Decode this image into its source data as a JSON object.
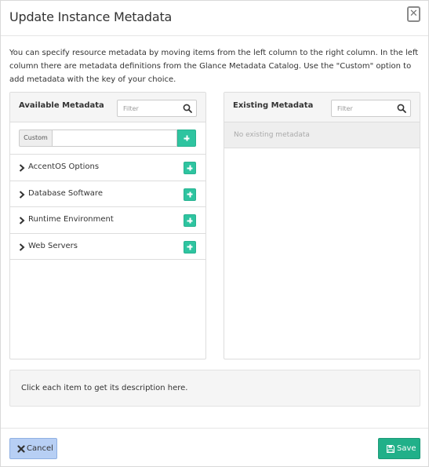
{
  "dialog": {
    "title": "Update Instance Metadata",
    "description": "You can specify resource metadata by moving items from the left column to the right column. In the left column there are metadata definitions from the Glance Metadata Catalog. Use the \"Custom\" option to add metadata with the key of your choice."
  },
  "available": {
    "title": "Available Metadata",
    "filter_placeholder": "Filter",
    "custom_label": "Custom",
    "custom_value": "",
    "items": [
      {
        "label": "AccentOS Options"
      },
      {
        "label": "Database Software"
      },
      {
        "label": "Runtime Environment"
      },
      {
        "label": "Web Servers"
      }
    ]
  },
  "existing": {
    "title": "Existing Metadata",
    "filter_placeholder": "Filter",
    "empty_text": "No existing metadata"
  },
  "info": {
    "text": "Click each item to get its description here."
  },
  "footer": {
    "cancel_label": "Cancel",
    "save_label": "Save"
  },
  "colors": {
    "accent": "#2ec4a0",
    "save": "#21b089",
    "cancel": "#b7cff4"
  },
  "icons": {
    "close": "close-icon",
    "search": "search-icon",
    "add": "plus-icon",
    "expand": "chevron-right-icon",
    "cancel": "times-icon",
    "save": "floppy-disk-icon"
  }
}
